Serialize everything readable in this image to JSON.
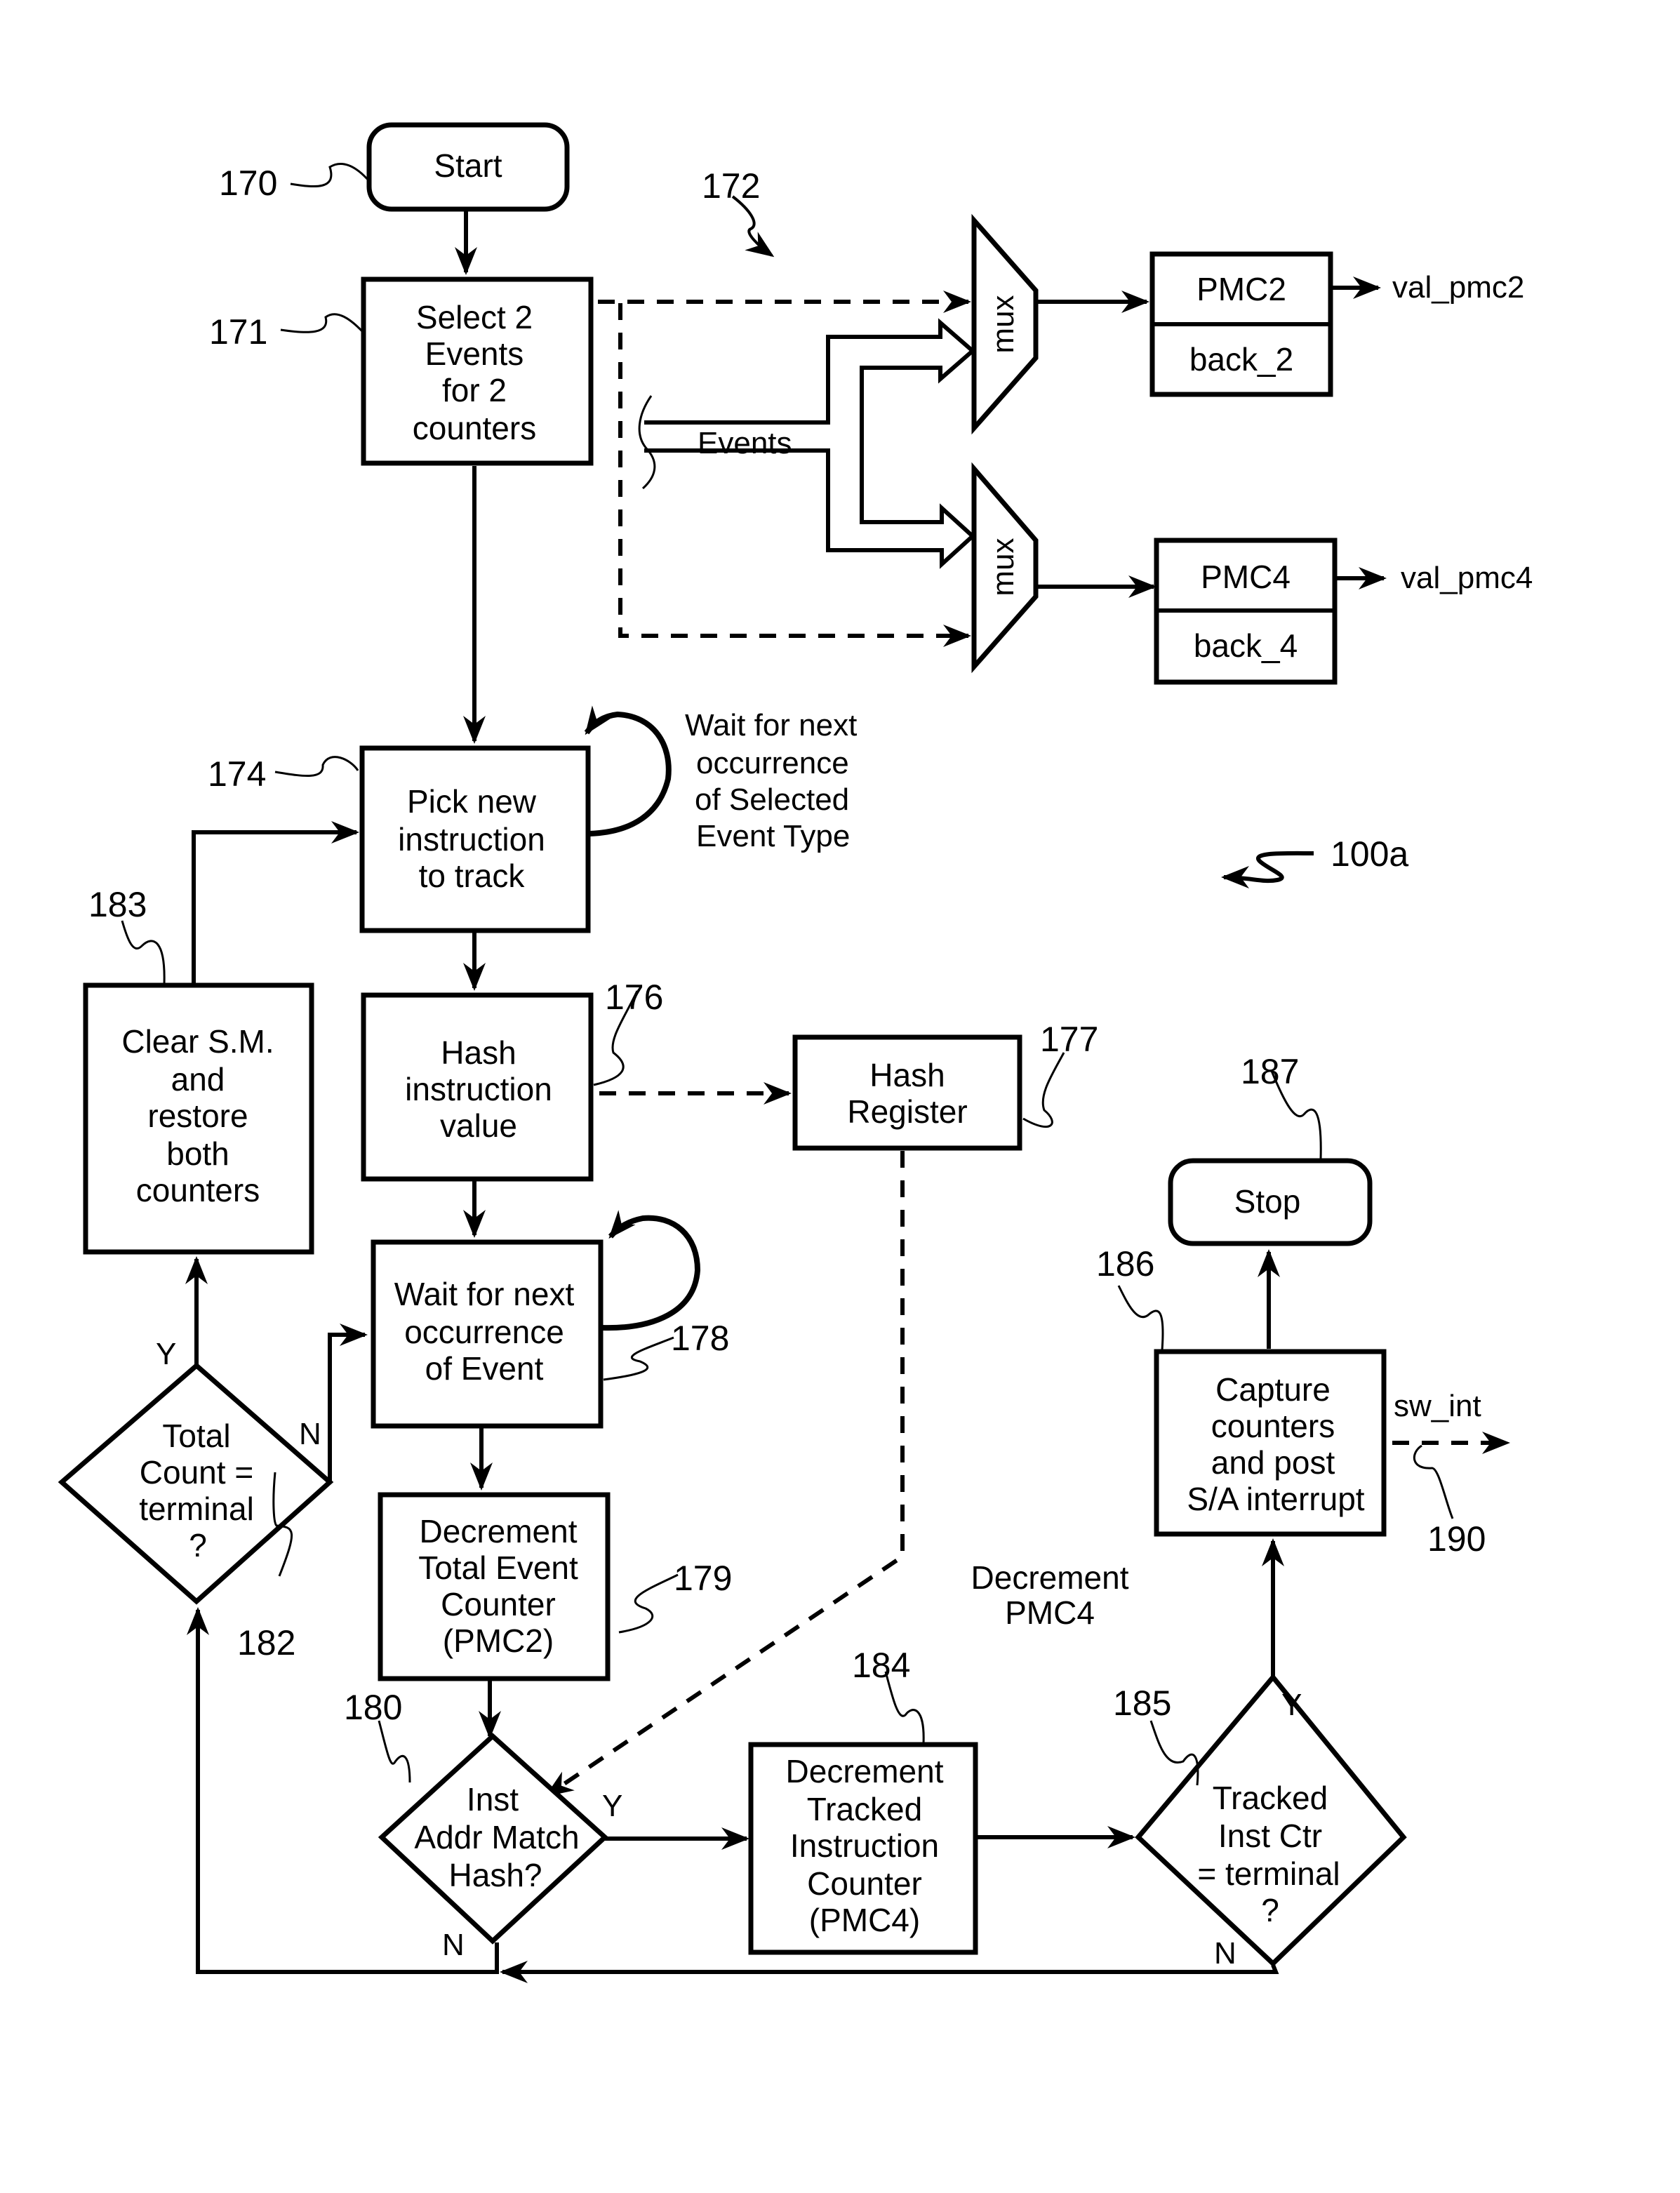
{
  "figure_id": "100a",
  "nodes": {
    "start": {
      "ref": "170",
      "label": "Start"
    },
    "select_events": {
      "ref": "171",
      "lines": [
        "Select 2",
        "Events",
        "for 2",
        "counters"
      ]
    },
    "hardware": {
      "ref": "172"
    },
    "pick_instruction": {
      "ref": "174",
      "lines": [
        "Pick new",
        "instruction",
        "to track"
      ]
    },
    "pick_loop_note": {
      "lines": [
        "Wait for next",
        "occurrence",
        "of Selected",
        "Event Type"
      ]
    },
    "hash_value": {
      "ref": "176",
      "lines": [
        "Hash",
        "instruction",
        "value"
      ]
    },
    "hash_register": {
      "ref": "177",
      "lines": [
        "Hash",
        "Register"
      ]
    },
    "wait_event": {
      "ref": "178",
      "lines": [
        "Wait for next",
        "occurrence",
        "of Event"
      ]
    },
    "decrement_total": {
      "ref": "179",
      "lines": [
        "Decrement",
        "Total Event",
        "Counter",
        "(PMC2)"
      ]
    },
    "addr_match": {
      "ref": "180",
      "lines": [
        "Inst",
        "Addr Match",
        "Hash?"
      ],
      "yes": "Y",
      "no": "N"
    },
    "total_count_terminal": {
      "ref": "182",
      "lines": [
        "Total",
        "Count =",
        "terminal",
        "?"
      ],
      "yes": "Y",
      "no": "N"
    },
    "clear_restore": {
      "ref": "183",
      "lines": [
        "Clear S.M.",
        "and",
        "restore",
        "both",
        "counters"
      ]
    },
    "decrement_tracked": {
      "ref": "184",
      "lines": [
        "Decrement",
        "Tracked",
        "Instruction",
        "Counter",
        "(PMC4)"
      ]
    },
    "decrement_pmc4_note": {
      "lines": [
        "Decrement",
        "PMC4"
      ]
    },
    "tracked_terminal": {
      "ref": "185",
      "lines": [
        "Tracked",
        "Inst Ctr",
        "= terminal",
        "?"
      ],
      "yes": "Y",
      "no": "N"
    },
    "capture": {
      "ref": "186",
      "lines": [
        "Capture",
        "counters",
        "and post",
        "S/A interrupt"
      ]
    },
    "stop": {
      "ref": "187",
      "label": "Stop"
    },
    "sw_int": {
      "ref": "190",
      "label": "sw_int"
    }
  },
  "hardware": {
    "events_label": "Events",
    "mux_top": "mux",
    "mux_bottom": "mux",
    "pmc2": {
      "main": "PMC2",
      "backup": "back_2",
      "output": "val_pmc2"
    },
    "pmc4": {
      "main": "PMC4",
      "backup": "back_4",
      "output": "val_pmc4"
    }
  }
}
